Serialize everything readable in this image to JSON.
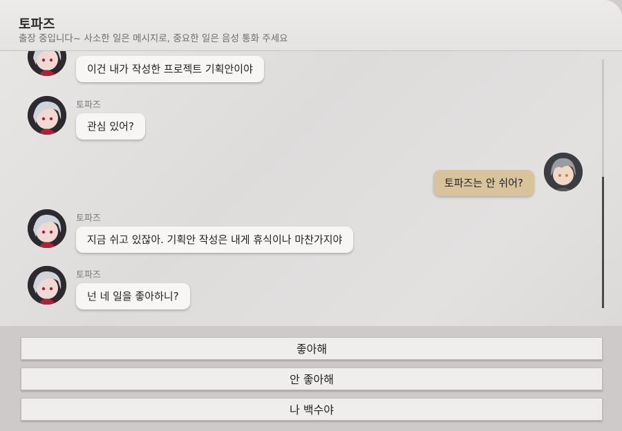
{
  "header": {
    "contact_name": "토파즈",
    "status": "출장 중입니다~ 사소한 일은 메시지로, 중요한 일은 음성 통화 주세요"
  },
  "messages": [
    {
      "sender": "",
      "text": "이건 내가 작성한 프로젝트 기획안이야",
      "direction": "in"
    },
    {
      "sender": "토파즈",
      "text": "관심 있어?",
      "direction": "in"
    },
    {
      "sender": "",
      "text": "토파즈는 안 쉬어?",
      "direction": "out"
    },
    {
      "sender": "토파즈",
      "text": "지금 쉬고 있잖아. 기획안 작성은 내게 휴식이나 마찬가지야",
      "direction": "in"
    },
    {
      "sender": "토파즈",
      "text": "넌 네 일을 좋아하니?",
      "direction": "in"
    }
  ],
  "choices": [
    {
      "label": "좋아해"
    },
    {
      "label": "안 좋아해"
    },
    {
      "label": "나 백수야"
    }
  ],
  "colors": {
    "incoming_bubble": "#f7f6f5",
    "outgoing_bubble": "#d7c39c",
    "background": "#e3e1e0"
  },
  "icons": {
    "contact_avatar": "topaz-avatar-icon",
    "player_avatar": "player-avatar-icon"
  }
}
